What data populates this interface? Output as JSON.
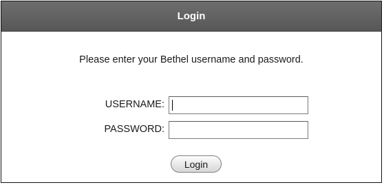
{
  "header": {
    "title": "Login"
  },
  "instructions": "Please enter your Bethel username and password.",
  "form": {
    "username_label": "USERNAME:",
    "username_value": "",
    "password_label": "PASSWORD:",
    "password_value": "",
    "submit_label": "Login"
  }
}
